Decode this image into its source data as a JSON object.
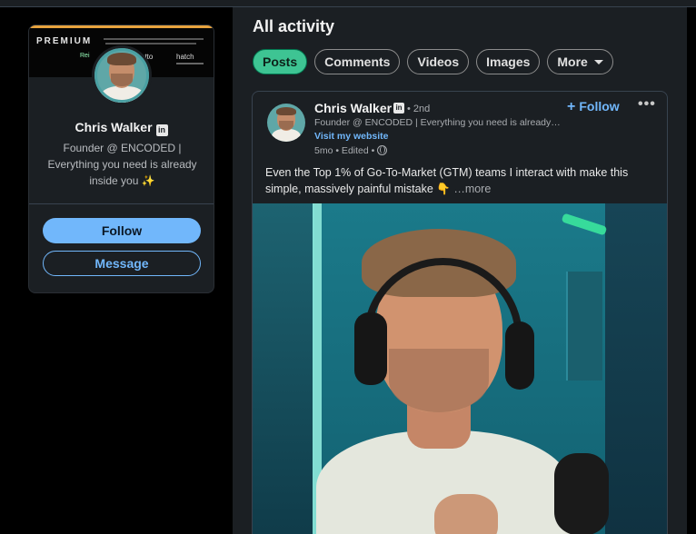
{
  "profile_card": {
    "premium_label": "PREMIUM",
    "banner_logo_1": "Rei",
    "banner_logo_2": "etto",
    "banner_logo_3": "hatch",
    "name": "Chris Walker",
    "linkedin_badge": "in",
    "headline": "Founder @ ENCODED | Everything you need is already inside you ✨",
    "follow_label": "Follow",
    "message_label": "Message"
  },
  "activity": {
    "title": "All activity",
    "filters": [
      {
        "label": "Posts",
        "active": true
      },
      {
        "label": "Comments",
        "active": false
      },
      {
        "label": "Videos",
        "active": false
      },
      {
        "label": "Images",
        "active": false
      },
      {
        "label": "More",
        "active": false
      }
    ]
  },
  "post": {
    "author": "Chris Walker",
    "linkedin_badge": "in",
    "degree": "• 2nd",
    "headline": "Founder @ ENCODED | Everything you need is already…",
    "website": "Visit my website",
    "meta": "5mo • Edited •",
    "follow_label": "Follow",
    "follow_plus": "+",
    "more_menu": "•••",
    "text": "Even the Top 1% of Go-To-Market (GTM) teams I interact with make this simple, massively painful mistake 👇",
    "see_more": "…more"
  },
  "colors": {
    "accent_blue": "#71b7fb",
    "active_pill": "#3ec493",
    "card_bg": "#1b1f23",
    "premium_gold": "#e7a33e"
  }
}
